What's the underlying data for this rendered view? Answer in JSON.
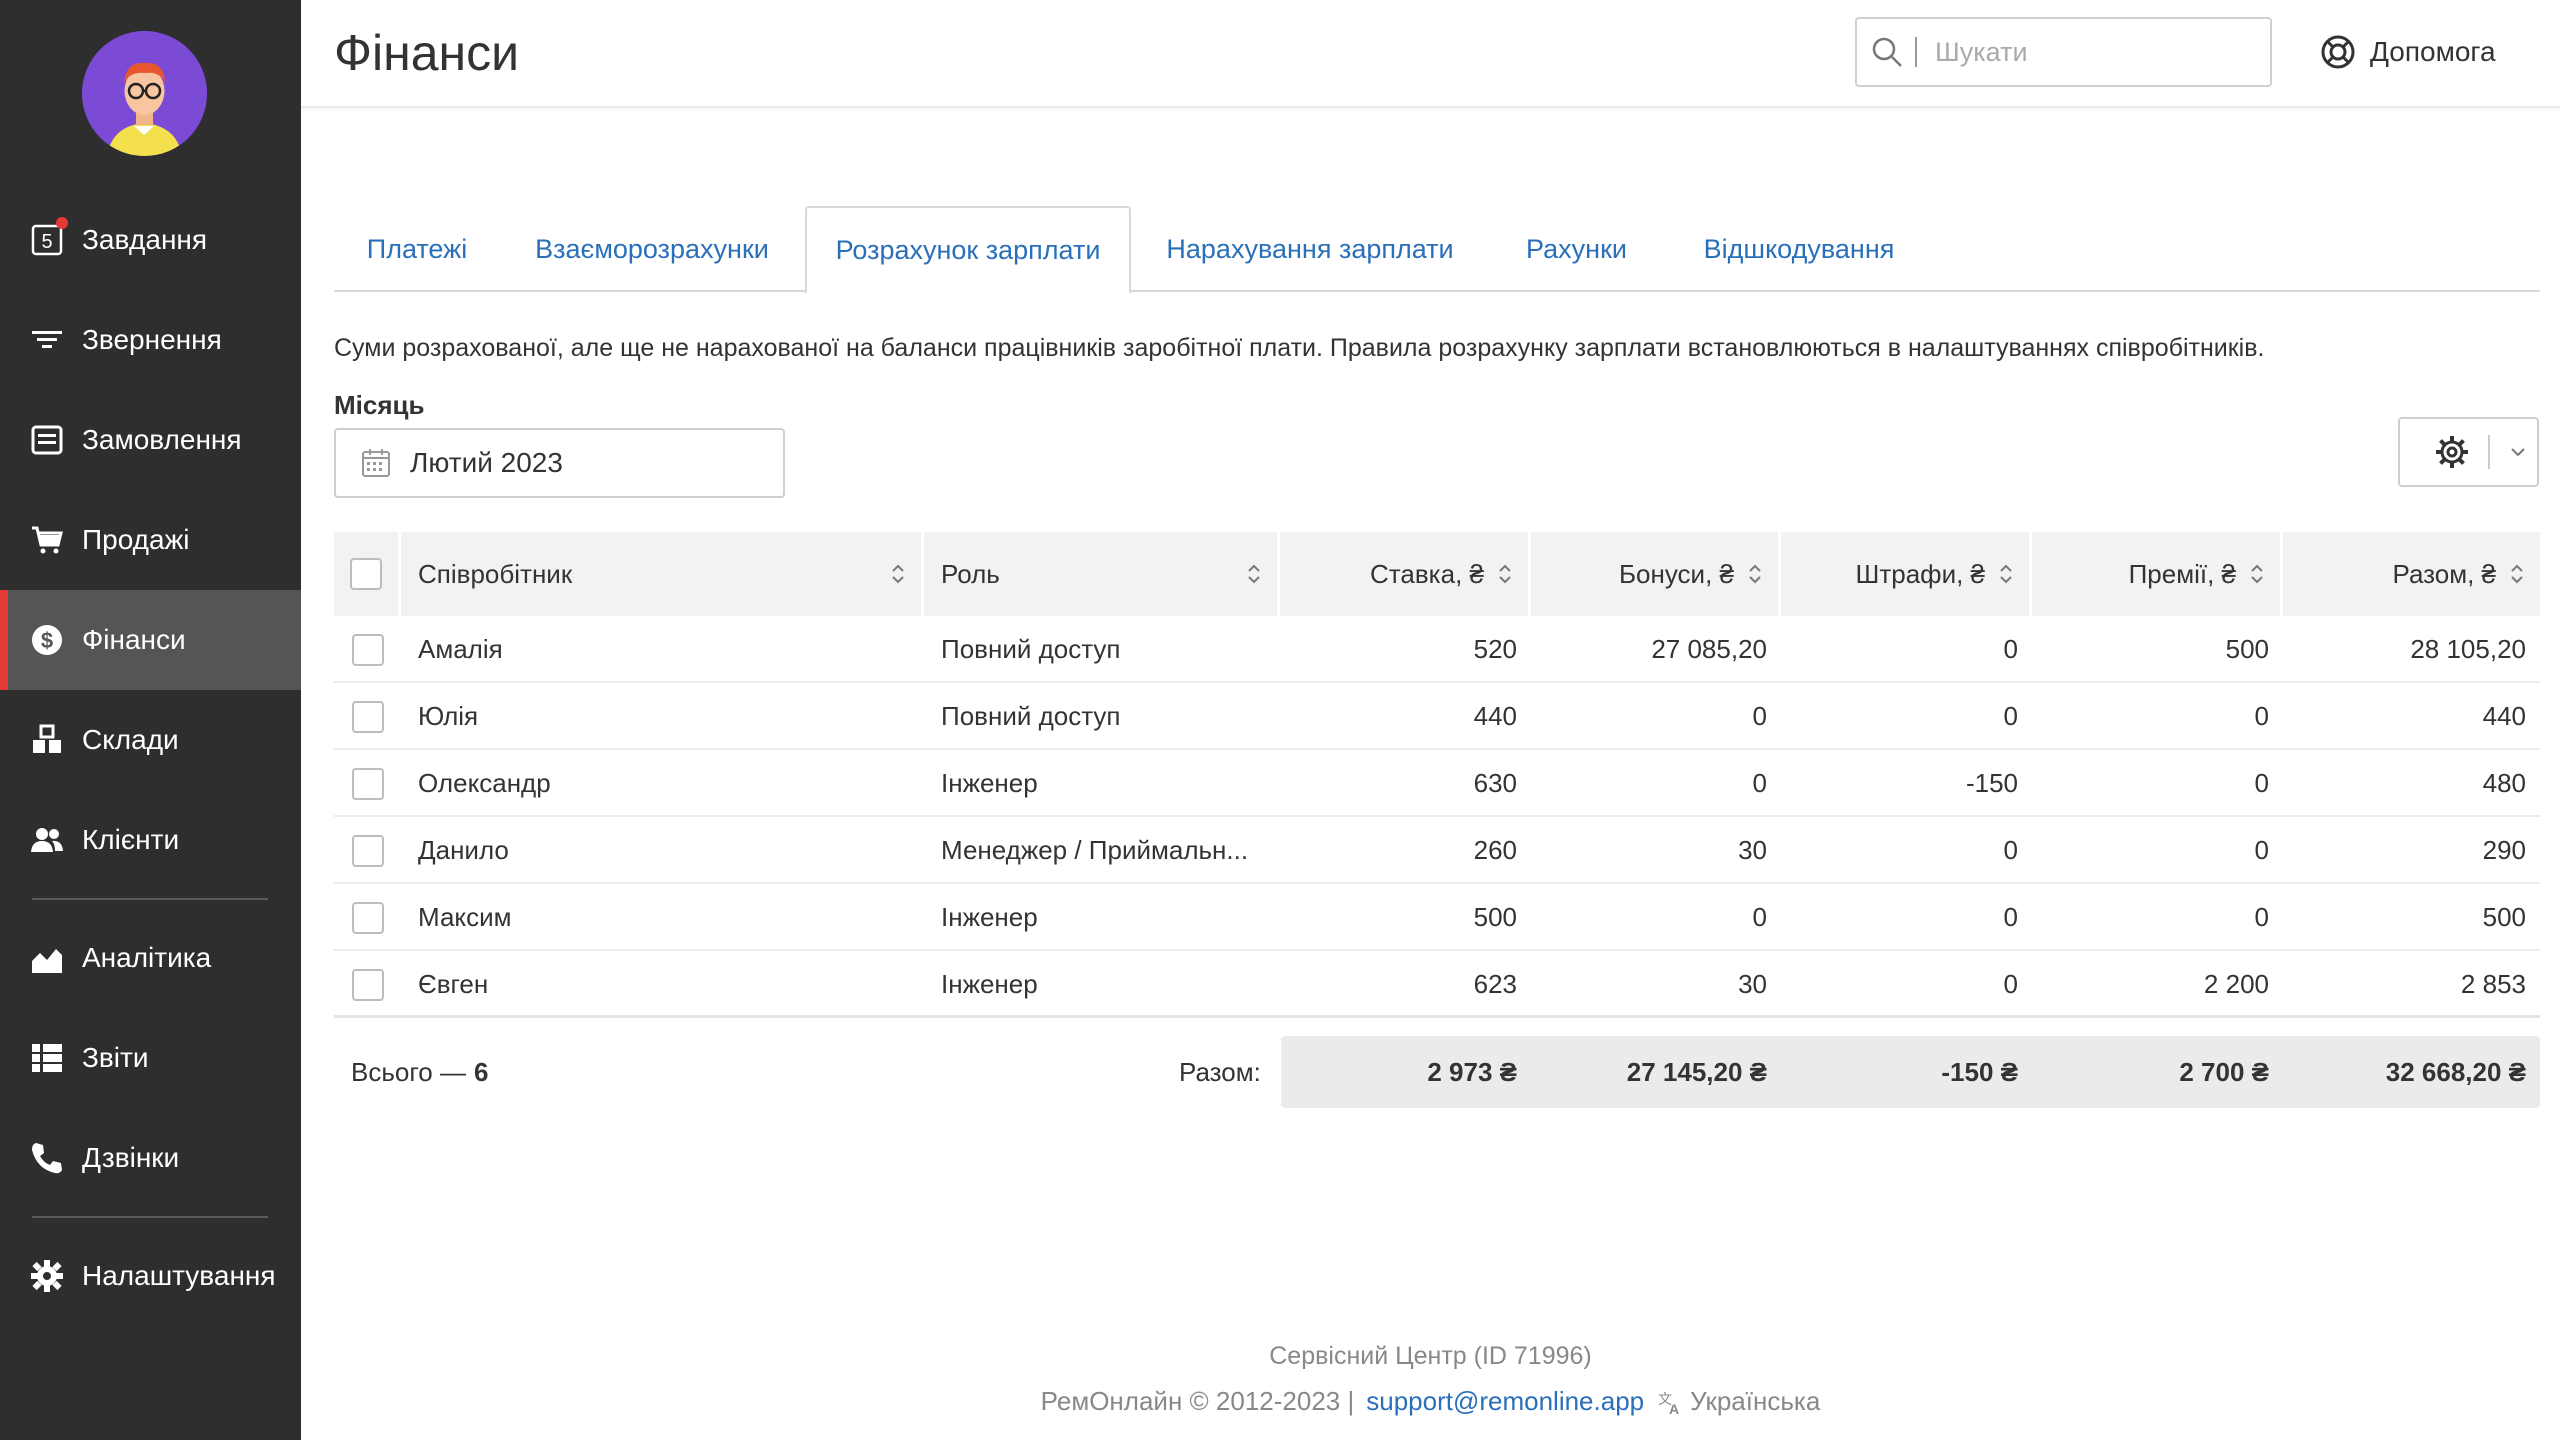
{
  "sidebar": {
    "badge_count": "5",
    "items": [
      {
        "label": "Завдання",
        "icon": "tasks-icon"
      },
      {
        "label": "Звернення",
        "icon": "filter-icon"
      },
      {
        "label": "Замовлення",
        "icon": "orders-icon"
      },
      {
        "label": "Продажі",
        "icon": "cart-icon"
      },
      {
        "label": "Фінанси",
        "icon": "dollar-icon",
        "active": true
      },
      {
        "label": "Склади",
        "icon": "warehouse-icon"
      },
      {
        "label": "Клієнти",
        "icon": "clients-icon"
      },
      {
        "label": "Аналітика",
        "icon": "analytics-icon"
      },
      {
        "label": "Звіти",
        "icon": "reports-icon"
      },
      {
        "label": "Дзвінки",
        "icon": "phone-icon"
      },
      {
        "label": "Налаштування",
        "icon": "gear-icon"
      }
    ]
  },
  "header": {
    "title": "Фінанси",
    "search_placeholder": "Шукати",
    "help_label": "Допомога"
  },
  "tabs": [
    "Платежі",
    "Взаєморозрахунки",
    "Розрахунок зарплати",
    "Нарахування зарплати",
    "Рахунки",
    "Відшкодування"
  ],
  "active_tab": "Розрахунок зарплати",
  "description": "Суми розрахованої, але ще не нарахованої на баланси працівників заробітної плати. Правила розрахунку зарплати встановлюються в налаштуваннях співробітників.",
  "month": {
    "label": "Місяць",
    "value": "Лютий 2023"
  },
  "table": {
    "columns": [
      "Співробітник",
      "Роль",
      "Ставка, ₴",
      "Бонуси, ₴",
      "Штрафи, ₴",
      "Премії, ₴",
      "Разом, ₴"
    ],
    "rows": [
      [
        "Амалія",
        "Повний доступ",
        "520",
        "27 085,20",
        "0",
        "500",
        "28 105,20"
      ],
      [
        "Юлія",
        "Повний доступ",
        "440",
        "0",
        "0",
        "0",
        "440"
      ],
      [
        "Олександр",
        "Інженер",
        "630",
        "0",
        "-150",
        "0",
        "480"
      ],
      [
        "Данило",
        "Менеджер / Приймальн...",
        "260",
        "30",
        "0",
        "0",
        "290"
      ],
      [
        "Максим",
        "Інженер",
        "500",
        "0",
        "0",
        "0",
        "500"
      ],
      [
        "Євген",
        "Інженер",
        "623",
        "30",
        "0",
        "2 200",
        "2 853"
      ]
    ]
  },
  "totals": {
    "count_label": "Всього —",
    "count": "6",
    "sum_label": "Разом:",
    "values": [
      "2 973 ₴",
      "27 145,20 ₴",
      "-150 ₴",
      "2 700 ₴",
      "32 668,20 ₴"
    ]
  },
  "footer": {
    "line1": "Сервісний Центр (ID 71996)",
    "copyright": "РемОнлайн © 2012-2023 |",
    "email": "support@remonline.app",
    "language": "Українська"
  },
  "colors": {
    "sidebar_bg": "#2e2e2e",
    "active_item_bg": "#555555",
    "accent_red": "#e53935",
    "link_blue": "#2a6fba"
  }
}
